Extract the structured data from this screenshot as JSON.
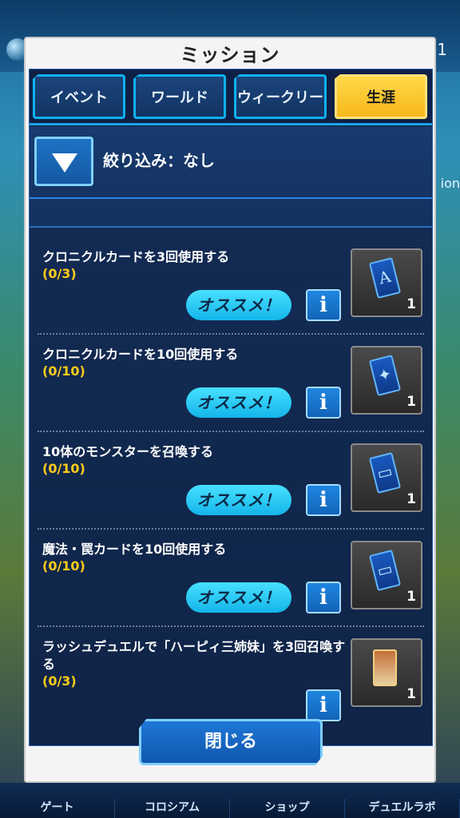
{
  "background": {
    "corner_number": "1",
    "side_text": "ion",
    "bottom_nav": [
      "ゲート",
      "コロシアム",
      "ショップ",
      "デュエルラボ"
    ]
  },
  "modal": {
    "title": "ミッション",
    "tabs": [
      {
        "label": "イベント",
        "active": false
      },
      {
        "label": "ワールド",
        "active": false
      },
      {
        "label": "ウィークリー",
        "active": false
      },
      {
        "label": "生涯",
        "active": true
      }
    ],
    "filter_label": "絞り込み：なし",
    "recommend_label": "オススメ！",
    "info_label": "i",
    "missions": [
      {
        "title": "クロニクルカードを3回使用する",
        "progress": "(0/3)",
        "recommended": true,
        "reward_count": "1",
        "reward_symbol": "A",
        "reward_icon": "card-a-icon"
      },
      {
        "title": "クロニクルカードを10回使用する",
        "progress": "(0/10)",
        "recommended": true,
        "reward_count": "1",
        "reward_symbol": "✦",
        "reward_icon": "card-star-icon"
      },
      {
        "title": "10体のモンスターを召喚する",
        "progress": "(0/10)",
        "recommended": true,
        "reward_count": "1",
        "reward_symbol": "▭",
        "reward_icon": "card-back-icon"
      },
      {
        "title": "魔法・罠カードを10回使用する",
        "progress": "(0/10)",
        "recommended": true,
        "reward_count": "1",
        "reward_symbol": "▭",
        "reward_icon": "card-back-icon"
      },
      {
        "title": "ラッシュデュエルで「ハーピィ三姉妹」を3回召喚する",
        "progress": "(0/3)",
        "recommended": false,
        "reward_count": "1",
        "reward_symbol": "",
        "reward_icon": "monster-card-icon"
      }
    ],
    "close_label": "閉じる"
  },
  "colors": {
    "accent": "#14b5ea",
    "active_tab": "#f7b81a",
    "progress": "#ffcc1a"
  }
}
